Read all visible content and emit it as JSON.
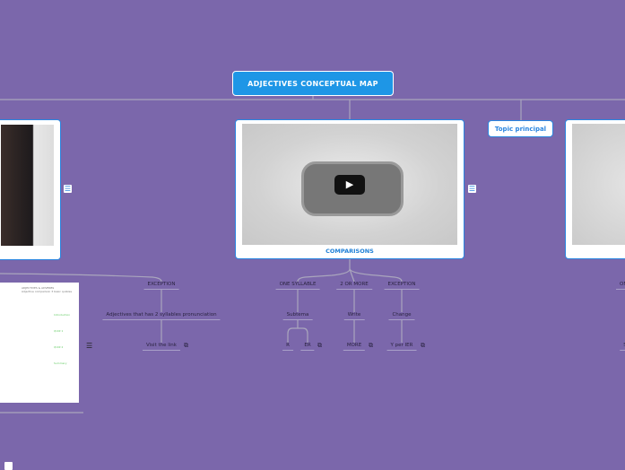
{
  "root": {
    "title": "ADJECTIVES CONCEPTUAL MAP"
  },
  "topic_principal": {
    "label": "Topic principal"
  },
  "center_card": {
    "caption": "COMPARISONS",
    "media": "video",
    "play_icon": "play-icon"
  },
  "center_branches": [
    {
      "label": "ONE SYLLABLE",
      "child": "Subtema",
      "leaves": [
        "R",
        "ER"
      ]
    },
    {
      "label": "2 OR MORE",
      "child": "Write",
      "leaves": [
        "MORE"
      ]
    },
    {
      "label": "EXCEPTION",
      "child": "Change",
      "leaves": [
        "Y per IER"
      ]
    }
  ],
  "left_branch": {
    "label": "EXCEPTION",
    "child": "Adjectives that has 2 syllables pronunciation",
    "leaf": "Visit the link"
  },
  "left_doc": {
    "title": "ADJECTIVES & ADVERBS",
    "subtitle": "Adjective comparison 3 basic quizzes",
    "items": [
      "Introduction",
      "QUIZ 1",
      "QUIZ 2",
      "Summary"
    ]
  },
  "right_branches": {
    "top": "ONE",
    "bottom": "S"
  },
  "colors": {
    "background": "#7b67ab",
    "accent": "#1e96e6",
    "card_border": "#2a86e0"
  }
}
